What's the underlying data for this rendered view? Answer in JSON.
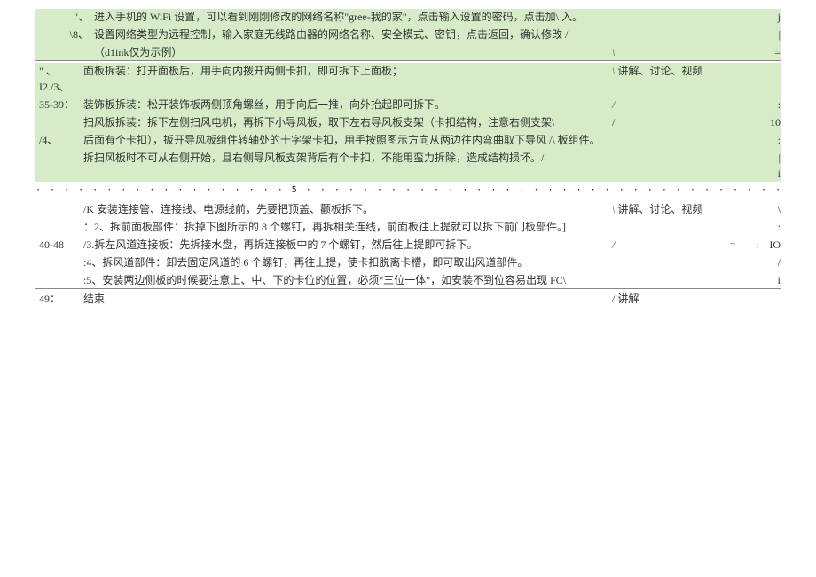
{
  "rows": {
    "r1_bullet": "\"、",
    "r1_text": "进入手机的 WiFi 设置，可以看到刚刚修改的网络名称\"gree-我的家\"，点击输入设置的密码，点击加\\ 入。",
    "r1_side": "j",
    "r2_bullet": "\\8、",
    "r2_text": "设置网络类型为远程控制，输入家庭无线路由器的网络名称、安全模式、密钥，点击返回，确认修改 /",
    "r2_side": "|",
    "r3_text": "（d1ink仅为示例）",
    "r3_side": "=",
    "r3_slash": "\\",
    "r4_num": "\" 、I2./3、",
    "r4_text": "面板拆装：打开面板后，用手向内拨开两侧卡扣，即可拆下上面板；",
    "r4_slash": "\\",
    "r4_right": "讲解、讨论、视频",
    "r5_num": "35-39：",
    "r5_text": "装饰板拆装：松开装饰板两侧顶角螺丝，用手向后一推，向外抬起即可拆下。",
    "r5_slash": "/",
    "r5_side": ":",
    "r6_text": "扫风板拆装：拆下左侧扫风电机，再拆下小导风板，取下左右导风板支架（卡扣结构，注意右侧支架\\",
    "r6_side": "/",
    "r6_far": "10",
    "r7_num": "/4、",
    "r7_text": "后面有个卡扣），扳开导风板组件转轴处的十字架卡扣，用手按照图示方向从两边往内弯曲取下导风 /\\ 板组件。",
    "r7_side": ":",
    "r8_text": "拆扫风板时不可从右侧开始，且右侧导风板支架背后有个卡扣，不能用蛮力拆除，造成结构损坏。/",
    "r8_side": "|\ni",
    "dotted_left": "5",
    "dotted_right": "$",
    "r9_text": "/K 安装连接管、连接线、电源线前，先要把顶盖、颧板拆下。",
    "r9_slash": "\\",
    "r9_right": "讲解、讨论、视频",
    "r9_side": "\\",
    "r10_text": "：2、拆前面板部件：拆掉下图所示的 8 个螺钉，再拆相关连线，前面板往上提就可以拆下前门板部件。]",
    "r10_side": ":",
    "r11_num": "40-48",
    "r11_text": "/3.拆左风道连接板：先拆接水盘，再拆连接板中的 7 个螺钉，然后往上提即可拆下。",
    "r11_slash": "/",
    "r11_side": "=",
    "r11_side2": ":",
    "r11_far": "IO",
    "r12_text": ":4、拆风道部件：卸去固定风道的 6 个螺钉，再往上提，使卡扣脱离卡槽，即可取出风道部件。",
    "r12_side": "/",
    "r13_text": ":5、安装两边侧板的时候要注意上、中、下的卡位的位置，必须\"三位一体\"，如安装不到位容易出现 FC\\",
    "r13_side": "i",
    "r14_num": "49：",
    "r14_text": "结束",
    "r14_right": "/ 讲解"
  }
}
